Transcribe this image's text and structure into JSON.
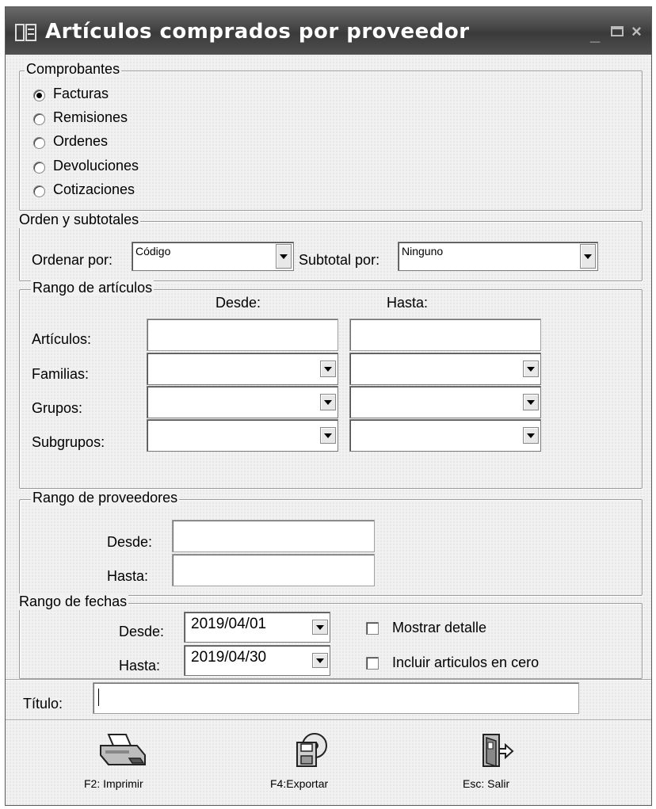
{
  "window": {
    "title": "Artículos comprados por proveedor"
  },
  "comprobantes": {
    "legend": "Comprobantes",
    "options": [
      {
        "label": "Facturas",
        "checked": true
      },
      {
        "label": "Remisiones",
        "checked": false
      },
      {
        "label": "Ordenes",
        "checked": false
      },
      {
        "label": "Devoluciones",
        "checked": false
      },
      {
        "label": "Cotizaciones",
        "checked": false
      }
    ]
  },
  "orden": {
    "legend": "Orden y subtotales",
    "ordenar_label": "Ordenar por:",
    "ordenar_value": "Código",
    "subtotal_label": "Subtotal por:",
    "subtotal_value": "Ninguno"
  },
  "rango_articulos": {
    "legend": "Rango de artículos",
    "desde_header": "Desde:",
    "hasta_header": "Hasta:",
    "rows": [
      "Artículos:",
      "Familias:",
      "Grupos:",
      "Subgrupos:"
    ]
  },
  "rango_proveedores": {
    "legend": "Rango de proveedores",
    "desde_label": "Desde:",
    "hasta_label": "Hasta:"
  },
  "rango_fechas": {
    "legend": "Rango de fechas",
    "desde_label": "Desde:",
    "desde_value": "2019/04/01",
    "hasta_label": "Hasta:",
    "hasta_value": "2019/04/30",
    "mostrar_detalle": "Mostrar detalle",
    "incluir_cero": "Incluir articulos en cero"
  },
  "titulo": {
    "label": "Título:",
    "value": ""
  },
  "toolbar": {
    "imprimir": "F2: Imprimir",
    "exportar": "F4:Exportar",
    "salir": "Esc: Salir"
  }
}
